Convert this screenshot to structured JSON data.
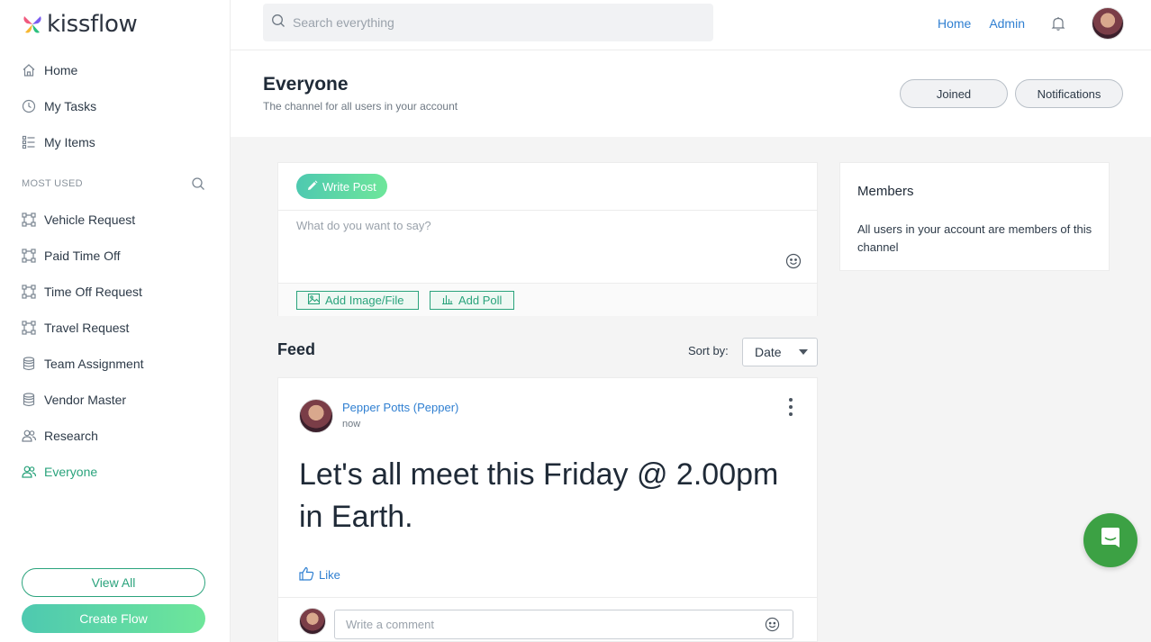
{
  "brand": {
    "logo_text": "kissflow"
  },
  "sidebar": {
    "nav": [
      {
        "label": "Home",
        "icon": "home-icon"
      },
      {
        "label": "My Tasks",
        "icon": "clock-icon"
      },
      {
        "label": "My Items",
        "icon": "list-icon"
      }
    ],
    "section_label": "MOST USED",
    "items": [
      {
        "label": "Vehicle Request",
        "icon": "flow-icon"
      },
      {
        "label": "Paid Time Off",
        "icon": "flow-icon"
      },
      {
        "label": "Time Off Request",
        "icon": "flow-icon"
      },
      {
        "label": "Travel Request",
        "icon": "flow-icon"
      },
      {
        "label": "Team Assignment",
        "icon": "database-icon"
      },
      {
        "label": "Vendor Master",
        "icon": "database-icon"
      },
      {
        "label": "Research",
        "icon": "people-icon"
      },
      {
        "label": "Everyone",
        "icon": "people-icon",
        "active": true
      }
    ],
    "view_all_label": "View All",
    "create_flow_label": "Create Flow"
  },
  "topbar": {
    "search_placeholder": "Search everything",
    "links": [
      "Home",
      "Admin"
    ]
  },
  "channel": {
    "title": "Everyone",
    "subtitle": "The channel for all users in your account",
    "joined_label": "Joined",
    "notifications_label": "Notifications"
  },
  "composer": {
    "tab_label": "Write Post",
    "placeholder": "What do you want to say?",
    "add_image_label": "Add Image/File",
    "add_poll_label": "Add Poll"
  },
  "feed": {
    "title": "Feed",
    "sort_label": "Sort by:",
    "sort_value": "Date",
    "post": {
      "author": "Pepper Potts (Pepper)",
      "time": "now",
      "body": "Let's all meet this Friday @ 2.00pm in Earth.",
      "like_label": "Like",
      "comment_placeholder": "Write a comment"
    }
  },
  "members": {
    "title": "Members",
    "text": "All users in your account are members of this channel"
  },
  "colors": {
    "accent": "#2aa37c",
    "link": "#2f7fd1",
    "chat": "#3ca144"
  }
}
